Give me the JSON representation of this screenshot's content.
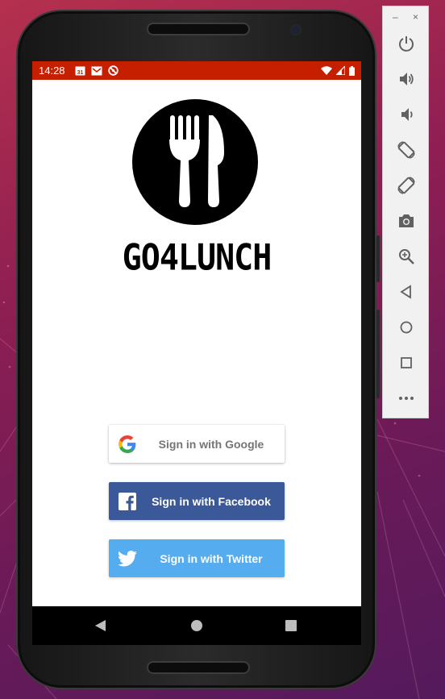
{
  "status_bar": {
    "time": "14:28",
    "calendar_day": "31",
    "background": "#c51f00"
  },
  "app": {
    "logo_text": "GO4LUNCH",
    "buttons": {
      "google": {
        "label": "Sign in with Google",
        "color": "#ffffff"
      },
      "facebook": {
        "label": "Sign in with Facebook",
        "color": "#3b5998"
      },
      "twitter": {
        "label": "Sign in with Twitter",
        "color": "#55acee"
      }
    }
  },
  "emulator_panel": {
    "window_controls": {
      "minimize": "–",
      "close": "×"
    },
    "controls": [
      "power-icon",
      "volume-up-icon",
      "volume-down-icon",
      "rotate-left-icon",
      "rotate-right-icon",
      "camera-icon",
      "zoom-icon",
      "back-icon",
      "home-icon",
      "overview-icon",
      "more-icon"
    ]
  }
}
